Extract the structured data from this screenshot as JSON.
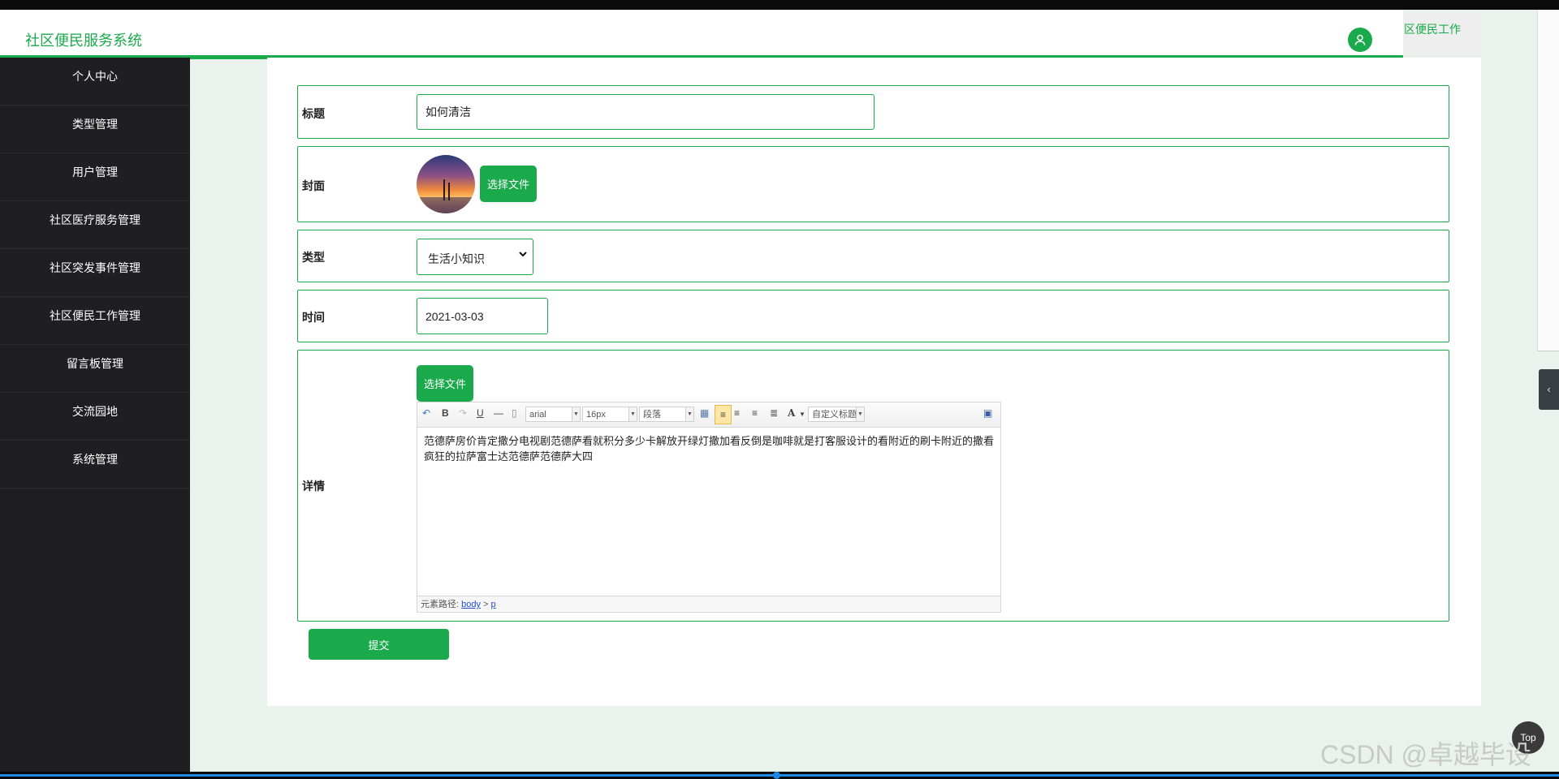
{
  "header": {
    "brand": "社区便民服务系统",
    "user_tab": "区便民工作"
  },
  "sidebar": {
    "items": [
      {
        "label": "个人中心"
      },
      {
        "label": "类型管理"
      },
      {
        "label": "用户管理"
      },
      {
        "label": "社区医疗服务管理"
      },
      {
        "label": "社区突发事件管理"
      },
      {
        "label": "社区便民工作管理"
      },
      {
        "label": "留言板管理"
      },
      {
        "label": "交流园地"
      },
      {
        "label": "系统管理"
      }
    ]
  },
  "form": {
    "title": {
      "label": "标题",
      "value": "如何清洁"
    },
    "cover": {
      "label": "封面",
      "button": "选择文件"
    },
    "type": {
      "label": "类型",
      "selected": "生活小知识"
    },
    "time": {
      "label": "时间",
      "value": "2021-03-03"
    },
    "detail": {
      "label": "详情",
      "button": "选择文件",
      "toolbar": {
        "font": "arial",
        "size": "16px",
        "paragraph": "段落",
        "custom_title": "自定义标题"
      },
      "content": "范德萨房价肯定撒分电视剧范德萨看就积分多少卡解放开绿灯撒加看反倒是咖啡就是打客服设计的看附近的刷卡附近的撒看疯狂的拉萨富士达范德萨范德萨大四",
      "path_label": "元素路径:",
      "path_body": "body",
      "path_sep": ">",
      "path_p": "p"
    },
    "submit": "提交"
  },
  "widgets": {
    "top_button": "Top",
    "watermark": "CSDN @卓越毕设"
  },
  "colors": {
    "accent": "#1aaa4b",
    "sidebar_bg": "#1f1f21",
    "page_bg": "#e9f2ec"
  }
}
